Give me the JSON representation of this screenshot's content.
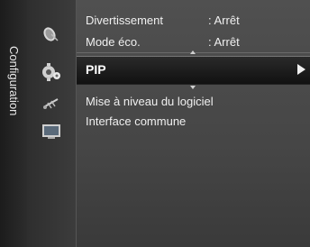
{
  "side_tab": {
    "label": "Configuration"
  },
  "icons": [
    {
      "name": "satellite-dish-icon"
    },
    {
      "name": "gear-settings-icon"
    },
    {
      "name": "antenna-icon"
    },
    {
      "name": "input-source-icon"
    }
  ],
  "menu": {
    "top_items": [
      {
        "label": "Divertissement",
        "value": ": Arrêt"
      },
      {
        "label": "Mode éco.",
        "value": ": Arrêt"
      }
    ],
    "selected_item": {
      "label": "PIP"
    },
    "bottom_items": [
      {
        "label": "Mise à niveau du logiciel"
      },
      {
        "label": "Interface commune"
      }
    ]
  },
  "colors": {
    "background": "#3a3a3a",
    "selected_row": "#111111",
    "text": "#f0f0f0"
  }
}
